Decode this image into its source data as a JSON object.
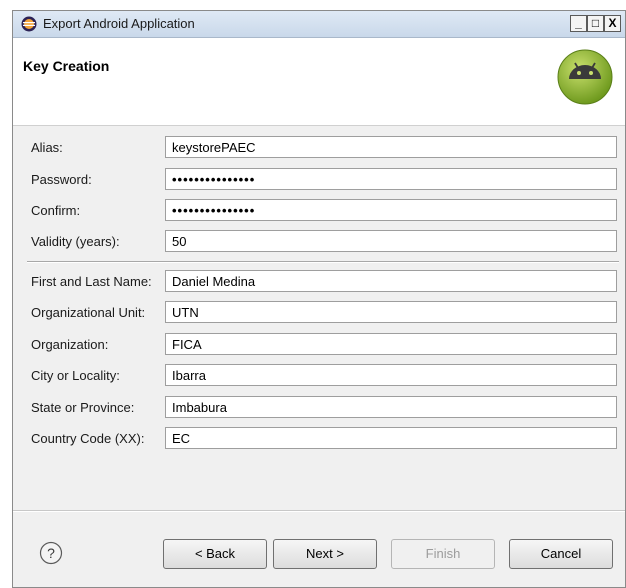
{
  "window": {
    "title": "Export Android Application",
    "minimize_glyph": "_",
    "maximize_glyph": "□",
    "close_glyph": "X"
  },
  "banner": {
    "title": "Key Creation",
    "logo_icon": "android-logo-icon"
  },
  "form": {
    "alias": {
      "label": "Alias:",
      "value": "keystorePAEC"
    },
    "password": {
      "label": "Password:",
      "value": "•••••••••••••••"
    },
    "confirm": {
      "label": "Confirm:",
      "value": "•••••••••••••••"
    },
    "validity": {
      "label": "Validity (years):",
      "value": "50"
    },
    "name": {
      "label": "First and Last Name:",
      "value": "Daniel Medina"
    },
    "org_unit": {
      "label": "Organizational Unit:",
      "value": "UTN"
    },
    "organization": {
      "label": "Organization:",
      "value": "FICA"
    },
    "city": {
      "label": "City or Locality:",
      "value": "Ibarra"
    },
    "state": {
      "label": "State or Province:",
      "value": "Imbabura"
    },
    "country": {
      "label": "Country Code (XX):",
      "value": "EC"
    }
  },
  "buttons": {
    "help_icon": "help-icon",
    "back": "< Back",
    "next": "Next >",
    "finish": "Finish",
    "cancel": "Cancel"
  },
  "colors": {
    "android_green": "#9bc83a",
    "titlebar": "#dfe9f5"
  }
}
